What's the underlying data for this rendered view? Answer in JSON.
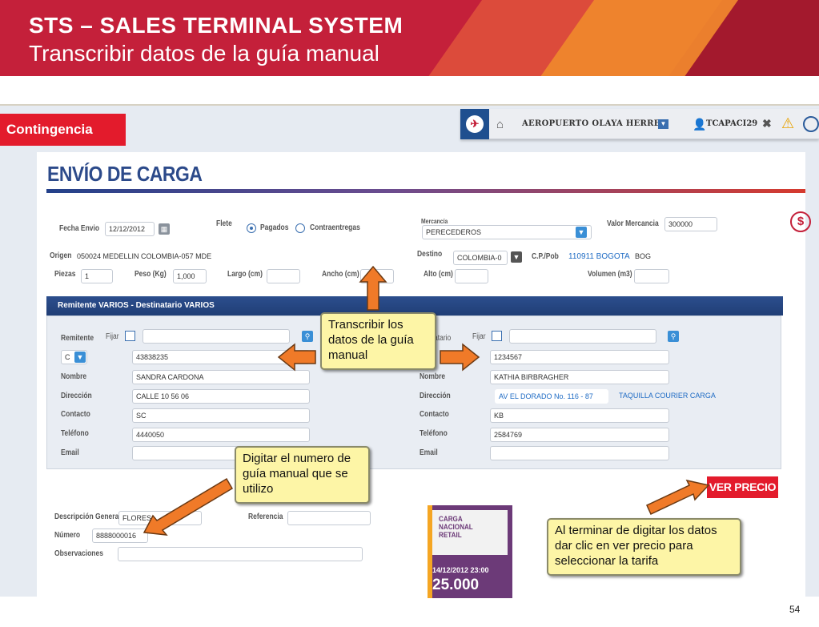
{
  "slide": {
    "title": "STS – SALES  TERMINAL SYSTEM",
    "subtitle": "Transcribir datos de la guía manual",
    "page_number": "54"
  },
  "topbar": {
    "airport": "AEROPUERTO OLAYA HERRER",
    "user": "TCAPACI29",
    "icons": [
      "airline-logo-icon",
      "home-icon",
      "chevron-down-icon",
      "user-icon",
      "close-icon",
      "warning-icon",
      "chat-icon"
    ]
  },
  "mode_label": "Contingencia",
  "form": {
    "page_title": "ENVÍO DE CARGA",
    "fecha_envio_label": "Fecha Envio",
    "fecha_envio_value": "12/12/2012",
    "flete_label": "Flete",
    "flete_opt1": "Pagados",
    "flete_opt2": "Contraentregas",
    "mercancia_label": "Mercancía",
    "mercancia_value": "PERECEDEROS",
    "valor_mercancia_label": "Valor Mercancia",
    "valor_mercancia_value": "300000",
    "origen_label": "Origen",
    "origen_value": "050024   MEDELLIN   COLOMBIA-057   MDE",
    "destino_label": "Destino",
    "destino_value": "COLOMBIA-0",
    "cp_label": "C.P./Pob",
    "cp_value": "110911 BOGOTA",
    "cp_code": "BOG",
    "piezas_label": "Piezas",
    "piezas_value": "1",
    "peso_label": "Peso (Kg)",
    "peso_value": "1,000",
    "largo_label": "Largo (cm)",
    "ancho_label": "Ancho (cm)",
    "alto_label": "Alto (cm)",
    "volumen_label": "Volumen (m3)",
    "section_title": "Remitente VARIOS - Destinatario VARIOS",
    "remitente": {
      "label": "Remitente",
      "fijar": "Fijar",
      "doc_type": "C",
      "doc": "43838235",
      "nombre_label": "Nombre",
      "nombre": "SANDRA CARDONA",
      "direccion_label": "Dirección",
      "direccion": "CALLE 10 56 06",
      "contacto_label": "Contacto",
      "contacto": "SC",
      "telefono_label": "Teléfono",
      "telefono": "4440050",
      "email_label": "Email"
    },
    "destinatario": {
      "label": "atario",
      "fijar": "Fijar",
      "doc": "1234567",
      "nombre_label": "Nombre",
      "nombre": "KATHIA BIRBRAGHER",
      "direccion_label": "Dirección",
      "direccion": "AV EL DORADO No. 116 - 87",
      "direccion_extra": "TAQUILLA COURIER CARGA",
      "contacto_label": "Contacto",
      "contacto": "KB",
      "telefono_label": "Teléfono",
      "telefono": "2584769",
      "email_label": "Email"
    },
    "descripcion_label": "Descripción General",
    "descripcion_value": "FLORES",
    "referencia_label": "Referencia",
    "numero_label": "Número",
    "numero_value": "8888000016",
    "observaciones_label": "Observaciones",
    "ver_precio": "VER PRECIO",
    "dollar_icon": "$",
    "promo": {
      "line1": "CARGA",
      "line2": "NACIONAL",
      "line3": "RETAIL",
      "date": "14/12/2012 23:00",
      "price": "25.000"
    }
  },
  "callouts": {
    "transcribir": "Transcribir los datos de la guía manual",
    "digitar": "Digitar el numero de guía manual que se utilizo",
    "terminar": "Al terminar de digitar los datos dar clic en ver precio para seleccionar la tarifa"
  },
  "colors": {
    "brand_red": "#c4203a",
    "navy": "#2c4a8a",
    "arrow_orange": "#f07a28",
    "callout_yellow": "#fdf5a6"
  }
}
